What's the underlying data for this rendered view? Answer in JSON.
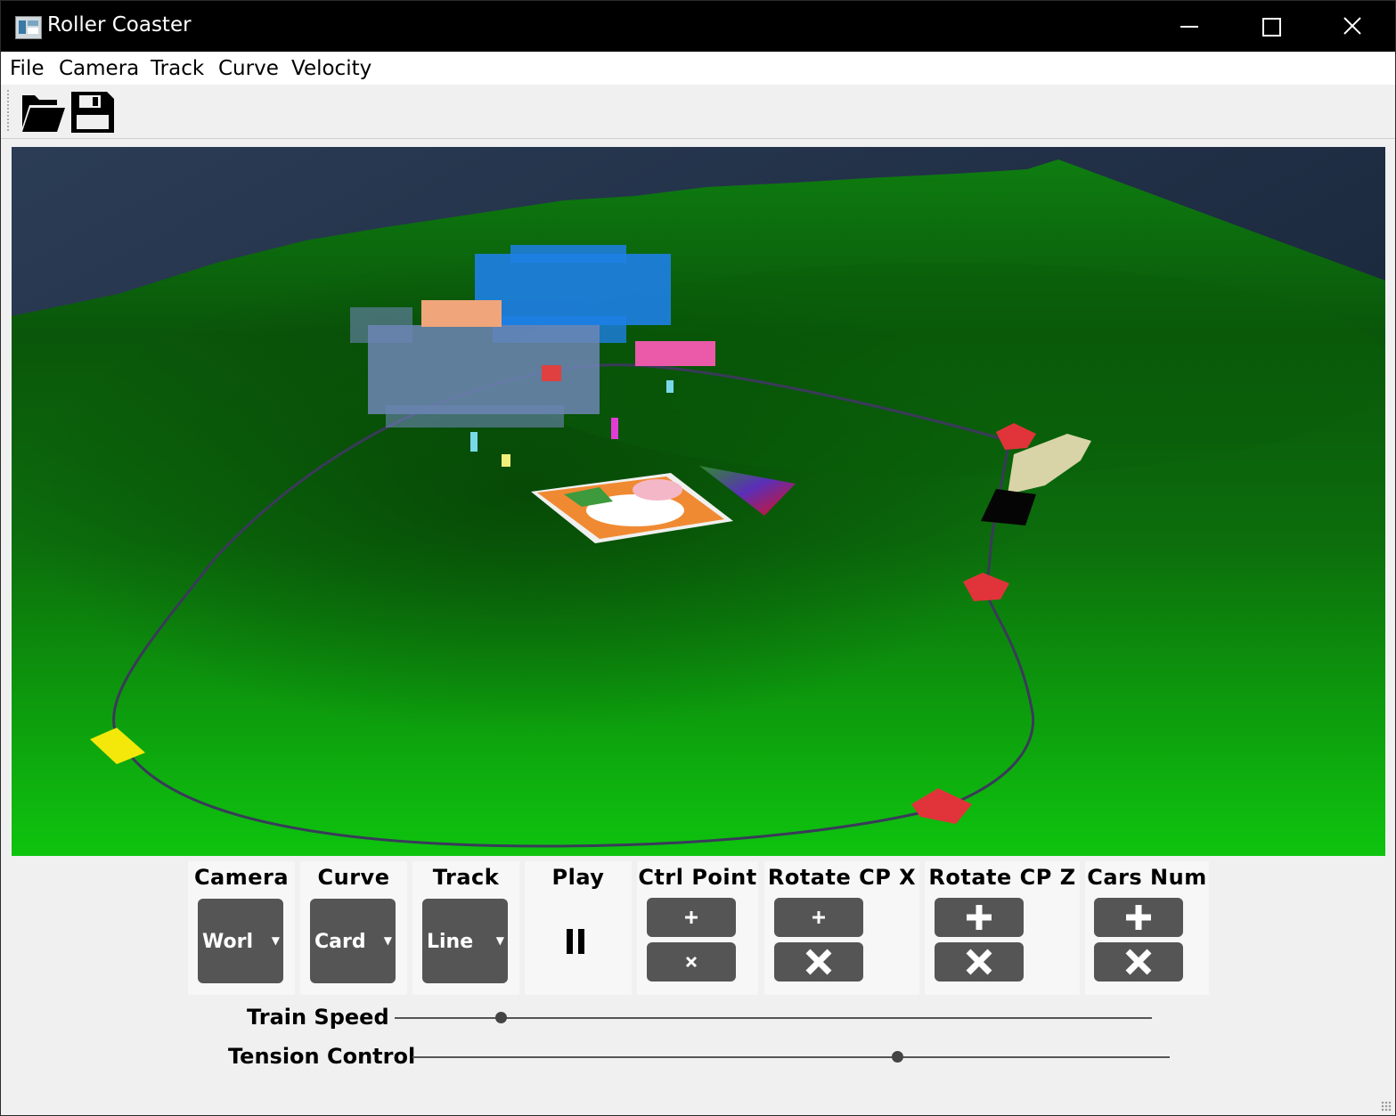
{
  "window": {
    "title": "Roller Coaster"
  },
  "menu": [
    "File",
    "Camera",
    "Track",
    "Curve",
    "Velocity"
  ],
  "toolbar": {
    "open_icon": "folder-open-icon",
    "save_icon": "save-disk-icon"
  },
  "controls": {
    "camera": {
      "label": "Camera",
      "value": "Worl"
    },
    "curve": {
      "label": "Curve",
      "value": "Card"
    },
    "track": {
      "label": "Track",
      "value": "Line"
    },
    "play": {
      "label": "Play",
      "state_icon": "pause-icon"
    },
    "ctrl_point": {
      "label": "Ctrl Point"
    },
    "rotate_cp_x": {
      "label": "Rotate  CP  X"
    },
    "rotate_cp_z": {
      "label": "Rotate  CP  Z"
    },
    "cars_num": {
      "label": "Cars  Num"
    }
  },
  "sliders": {
    "train_speed": {
      "label": "Train  Speed",
      "value_fraction": 0.14
    },
    "tension_control": {
      "label": "Tension  Control",
      "value_fraction": 0.64
    }
  }
}
